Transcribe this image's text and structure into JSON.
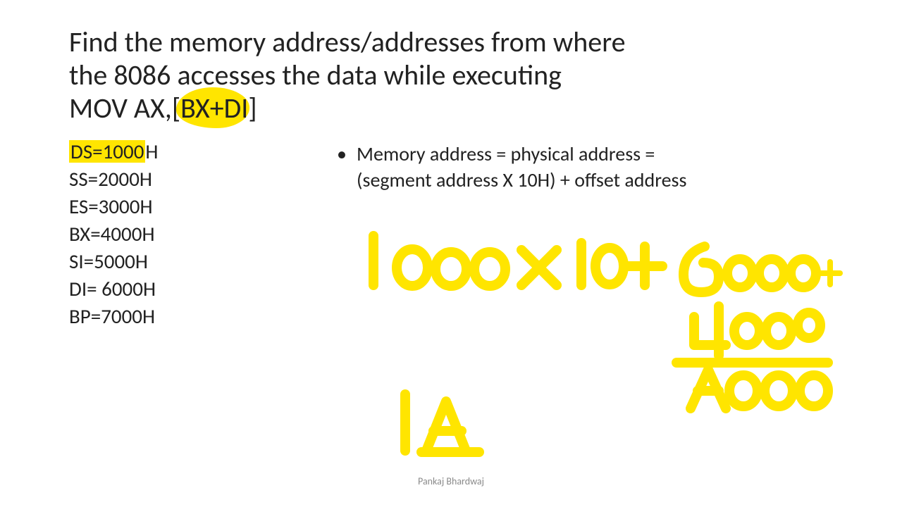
{
  "title": {
    "line1": "Find the memory address/addresses from where",
    "line2": "the 8086 accesses the data while executing",
    "line3_pre": "MOV AX,[",
    "line3_hl": "BX+DI",
    "line3_post": "]"
  },
  "registers": {
    "ds_label": "DS=1000",
    "ds_suffix": "H",
    "ss": "SS=2000H",
    "es": "ES=3000H",
    "bx": "BX=4000H",
    "si": "SI=5000H",
    "di": "DI= 6000H",
    "bp": "BP=7000H"
  },
  "bullet": {
    "line1": "Memory address = physical address =",
    "line2": "(segment address X 10H) + offset address"
  },
  "handwriting": {
    "expr_segment": "1000",
    "expr_times": "×",
    "expr_ten": "10",
    "expr_plus": "+",
    "expr_di": "6000 +",
    "expr_bx": "4000",
    "expr_sum": "A000",
    "partial_result": "1A"
  },
  "footer": "Pankaj Bhardwaj"
}
